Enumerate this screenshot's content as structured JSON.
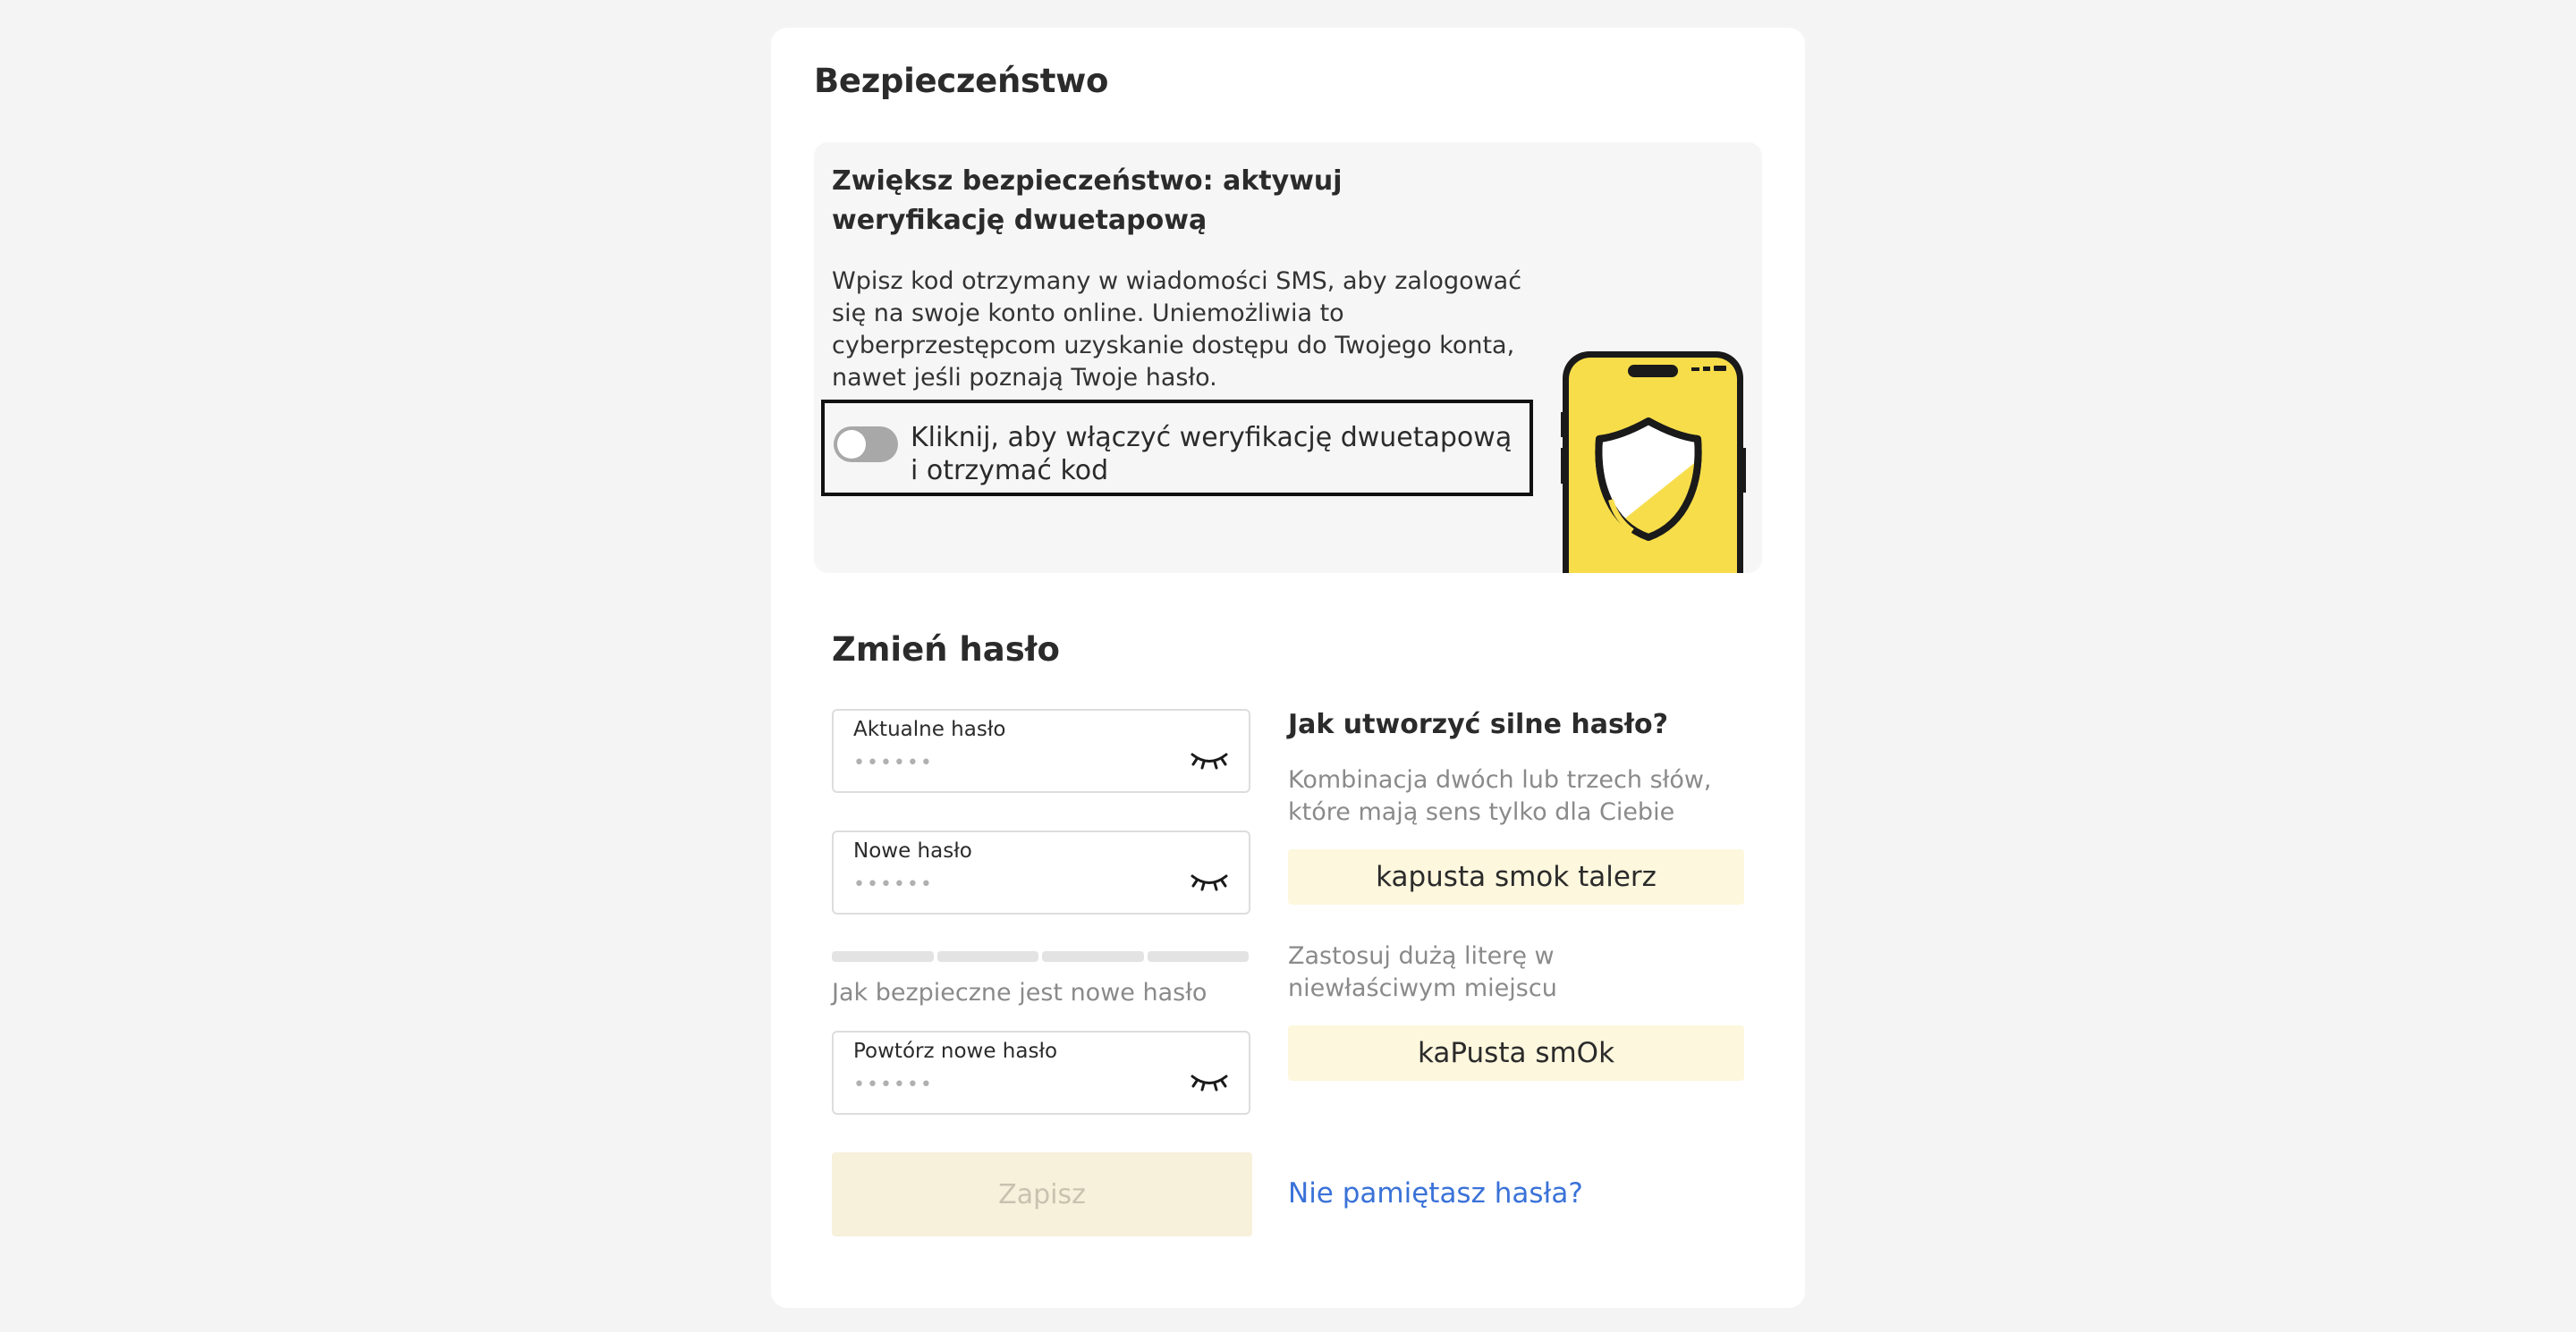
{
  "security": {
    "title": "Bezpieczeństwo",
    "twofa": {
      "title": "Zwiększ bezpieczeństwo: aktywuj weryfikację dwuetapową",
      "description": "Wpisz kod otrzymany w wiadomości SMS, aby zalogować się na swoje konto online. Uniemożliwia to cyberprzestępcom uzyskanie dostępu do Twojego konta, nawet jeśli poznają Twoje hasło.",
      "toggle_label": "Kliknij, aby włączyć weryfikację dwuetapową i otrzymać kod",
      "toggle_on": false
    }
  },
  "change_password": {
    "title": "Zmień hasło",
    "fields": [
      {
        "label": "Aktualne hasło",
        "value": "••••••"
      },
      {
        "label": "Nowe hasło",
        "value": "••••••"
      },
      {
        "label": "Powtórz nowe hasło",
        "value": "••••••"
      }
    ],
    "strength_label": "Jak bezpieczne jest nowe hasło",
    "strength_segments_filled": 0,
    "save_label": "Zapisz",
    "forgot_label": "Nie pamiętasz hasła?"
  },
  "tips": {
    "title": "Jak utworzyć silne hasło?",
    "items": [
      {
        "text": "Kombinacja dwóch lub trzech słów, które mają sens tylko dla Ciebie",
        "example": "kapusta smok talerz"
      },
      {
        "text": "Zastosuj dużą literę w niewłaściwym miejscu",
        "example": "kaPusta smOk"
      }
    ]
  },
  "colors": {
    "accent_yellow": "#f7dd4a",
    "link_blue": "#3a72d8",
    "save_disabled_bg": "#f7f0da",
    "tip_bg": "#fdf7dd"
  },
  "icons": [
    "eye-closed-icon",
    "shield-icon",
    "phone-illustration"
  ]
}
